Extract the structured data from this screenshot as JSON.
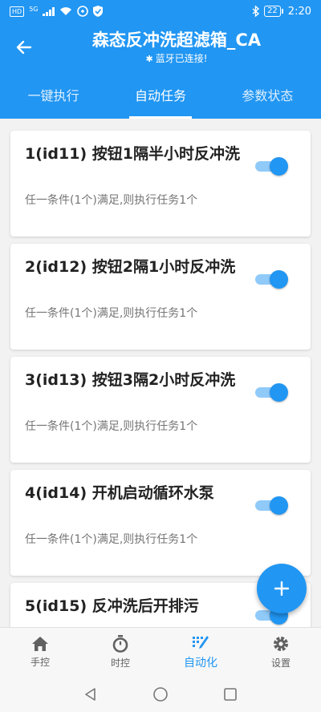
{
  "status_bar": {
    "hd_label": "HD",
    "net_label": "5G",
    "battery": "22",
    "time": "2:20"
  },
  "app_bar": {
    "title": "森态反冲洗超滤箱_CA",
    "subtitle": "蓝牙已连接!"
  },
  "tabs": [
    {
      "label": "一键执行"
    },
    {
      "label": "自动任务"
    },
    {
      "label": "参数状态"
    }
  ],
  "tasks": [
    {
      "title": "1(id11) 按钮1隔半小时反冲洗",
      "subtitle": "任一条件(1个)满足,则执行任务1个",
      "enabled": true
    },
    {
      "title": "2(id12) 按钮2隔1小时反冲洗",
      "subtitle": "任一条件(1个)满足,则执行任务1个",
      "enabled": true
    },
    {
      "title": "3(id13) 按钮3隔2小时反冲洗",
      "subtitle": "任一条件(1个)满足,则执行任务1个",
      "enabled": true
    },
    {
      "title": "4(id14) 开机启动循环水泵",
      "subtitle": "任一条件(1个)满足,则执行任务1个",
      "enabled": true
    },
    {
      "title": "5(id15) 反冲洗后开排污",
      "subtitle": "",
      "enabled": true
    }
  ],
  "bottom_nav": [
    {
      "label": "手控",
      "icon": "home-icon"
    },
    {
      "label": "时控",
      "icon": "stopwatch-icon"
    },
    {
      "label": "自动化",
      "icon": "automation-icon"
    },
    {
      "label": "设置",
      "icon": "gear-icon"
    }
  ],
  "colors": {
    "primary": "#2196f3",
    "toggle_track": "#90caf9",
    "background": "#f2f2f2"
  }
}
